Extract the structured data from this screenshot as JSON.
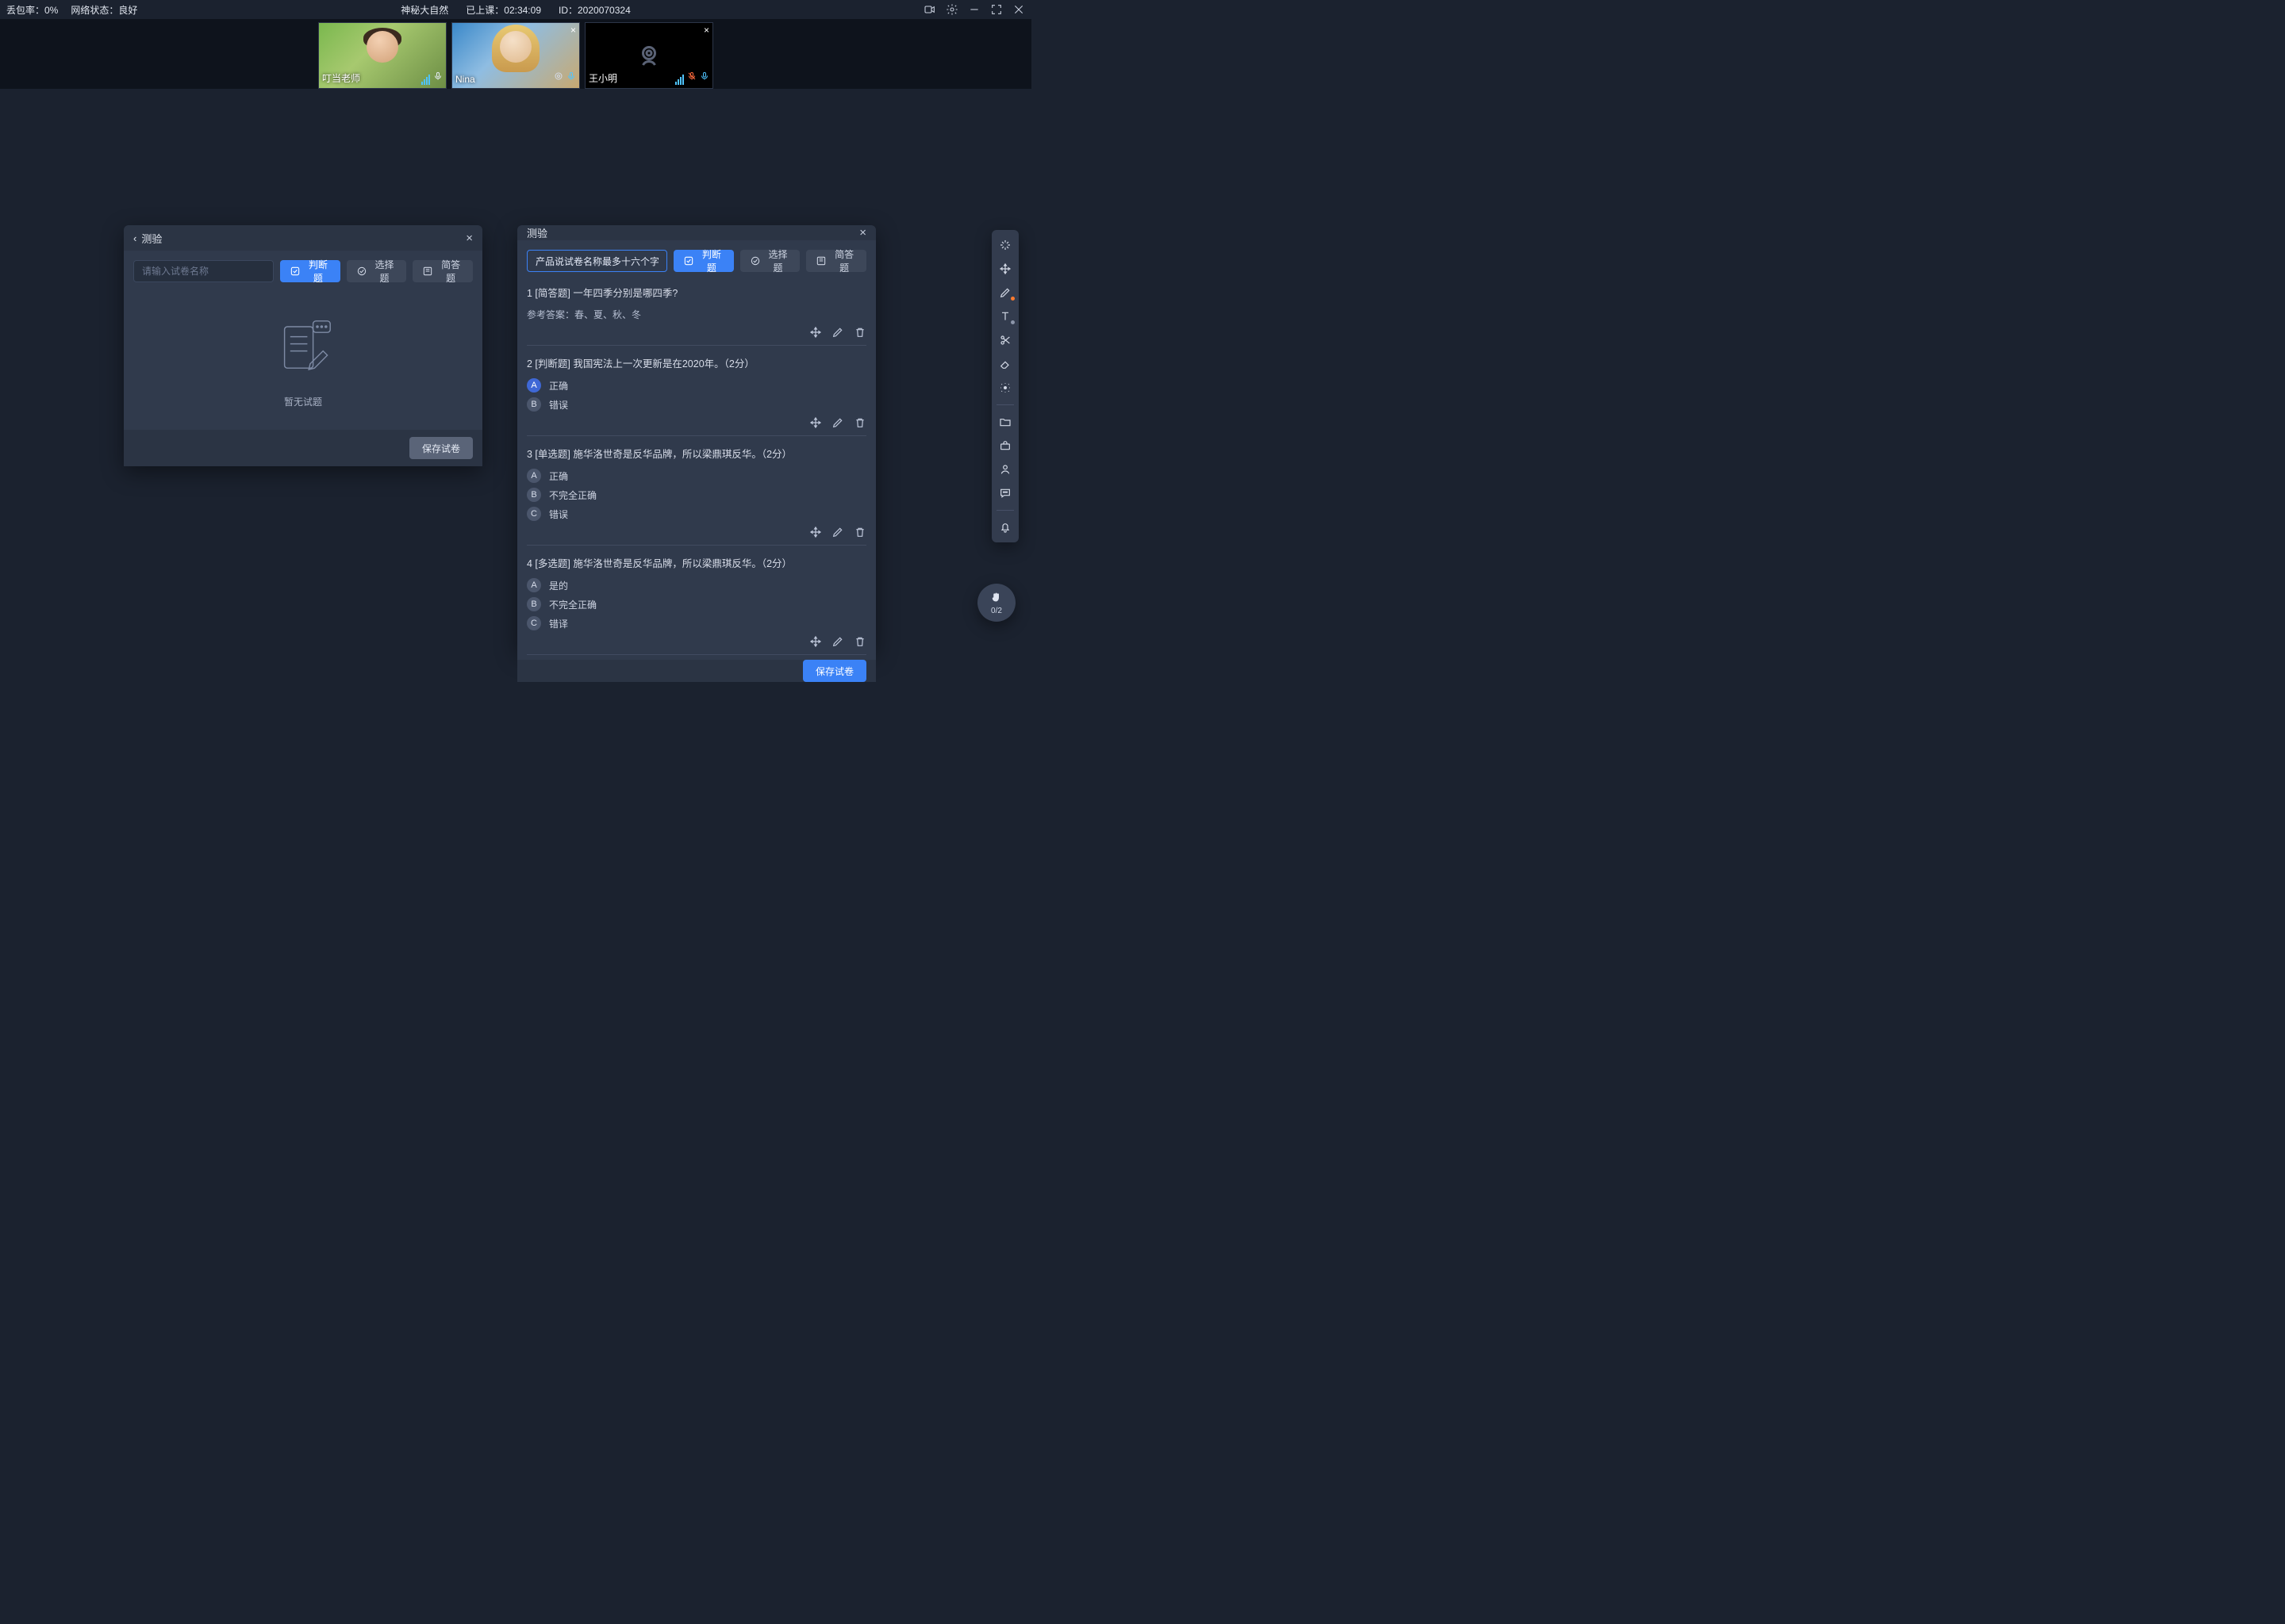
{
  "top": {
    "loss_rate": "丢包率：0%",
    "net_state": "网络状态：良好",
    "course_title": "神秘大自然",
    "elapsed": "已上课：02:34:09",
    "session_id": "ID：2020070324"
  },
  "participants": [
    {
      "name": "叮当老师",
      "has_close": false,
      "mic_color": "#4fc4ff",
      "camera_on": true
    },
    {
      "name": "Nina",
      "has_close": true,
      "mic_color": "#4fc4ff",
      "camera_on": true
    },
    {
      "name": "王小明",
      "has_close": true,
      "mic_color": "#4fc4ff",
      "mic_muted": true,
      "camera_on": false
    }
  ],
  "panel_left": {
    "title": "测验",
    "input_placeholder": "请输入试卷名称",
    "chips": {
      "judge": "判断题",
      "choice": "选择题",
      "short": "简答题"
    },
    "empty": "暂无试题",
    "save": "保存试卷"
  },
  "panel_right": {
    "title": "测验",
    "title_input_value": "产品说试卷名称最多十六个字",
    "chips": {
      "judge": "判断题",
      "choice": "选择题",
      "short": "简答题"
    },
    "save": "保存试卷",
    "questions": [
      {
        "header": "1 [简答题] 一年四季分别是哪四季?",
        "answer_label": "参考答案：春、夏、秋、冬"
      },
      {
        "header": "2 [判断题] 我国宪法上一次更新是在2020年。（2分）",
        "options": [
          {
            "letter": "A",
            "text": "正确",
            "selected": true
          },
          {
            "letter": "B",
            "text": "错误",
            "selected": false
          }
        ]
      },
      {
        "header": "3 [单选题] 施华洛世奇是反华品牌，所以梁鼎琪反华。（2分）",
        "options": [
          {
            "letter": "A",
            "text": "正确",
            "selected": false
          },
          {
            "letter": "B",
            "text": "不完全正确",
            "selected": false
          },
          {
            "letter": "C",
            "text": "错误",
            "selected": false
          }
        ]
      },
      {
        "header": "4 [多选题] 施华洛世奇是反华品牌，所以梁鼎琪反华。（2分）",
        "options": [
          {
            "letter": "A",
            "text": "是的",
            "selected": false
          },
          {
            "letter": "B",
            "text": "不完全正确",
            "selected": false
          },
          {
            "letter": "C",
            "text": "错译",
            "selected": false
          }
        ]
      }
    ]
  },
  "hand": {
    "count": "0/2"
  }
}
